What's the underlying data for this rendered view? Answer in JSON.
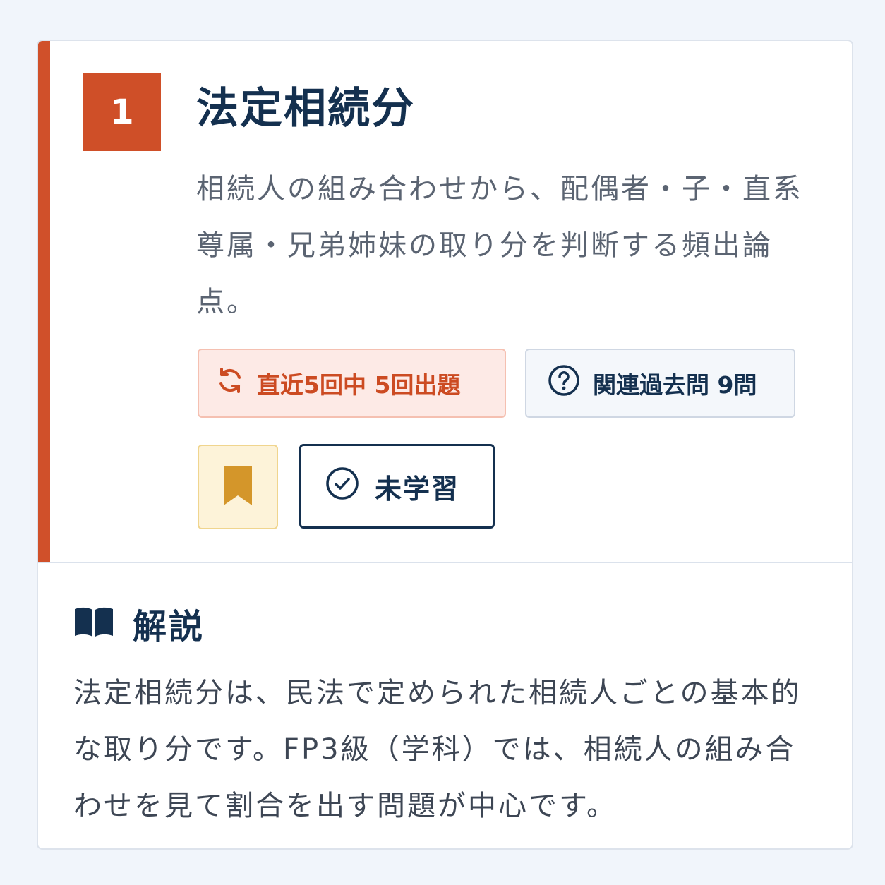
{
  "topic": {
    "number": "1",
    "title": "法定相続分",
    "description": "相続人の組み合わせから、配偶者・子・直系尊属・兄弟姉妹の取り分を判断する頻出論点。"
  },
  "badges": {
    "frequency": {
      "icon": "refresh-icon",
      "label": "直近5回中 5回出題"
    },
    "related": {
      "icon": "question-circle-icon",
      "label": "関連過去問 9問"
    }
  },
  "actions": {
    "bookmark_icon": "bookmark-icon",
    "status_icon": "check-circle-icon",
    "status_label": "未学習"
  },
  "explanation": {
    "icon": "book-icon",
    "heading": "解説",
    "body": "法定相続分は、民法で定められた相続人ごとの基本的な取り分です。FP3級（学科）では、相続人の組み合わせを見て割合を出す問題が中心です。"
  },
  "colors": {
    "accent": "#d0502a",
    "navy": "#14304f",
    "bookmark": "#d4962a",
    "background": "#f1f5fb"
  }
}
